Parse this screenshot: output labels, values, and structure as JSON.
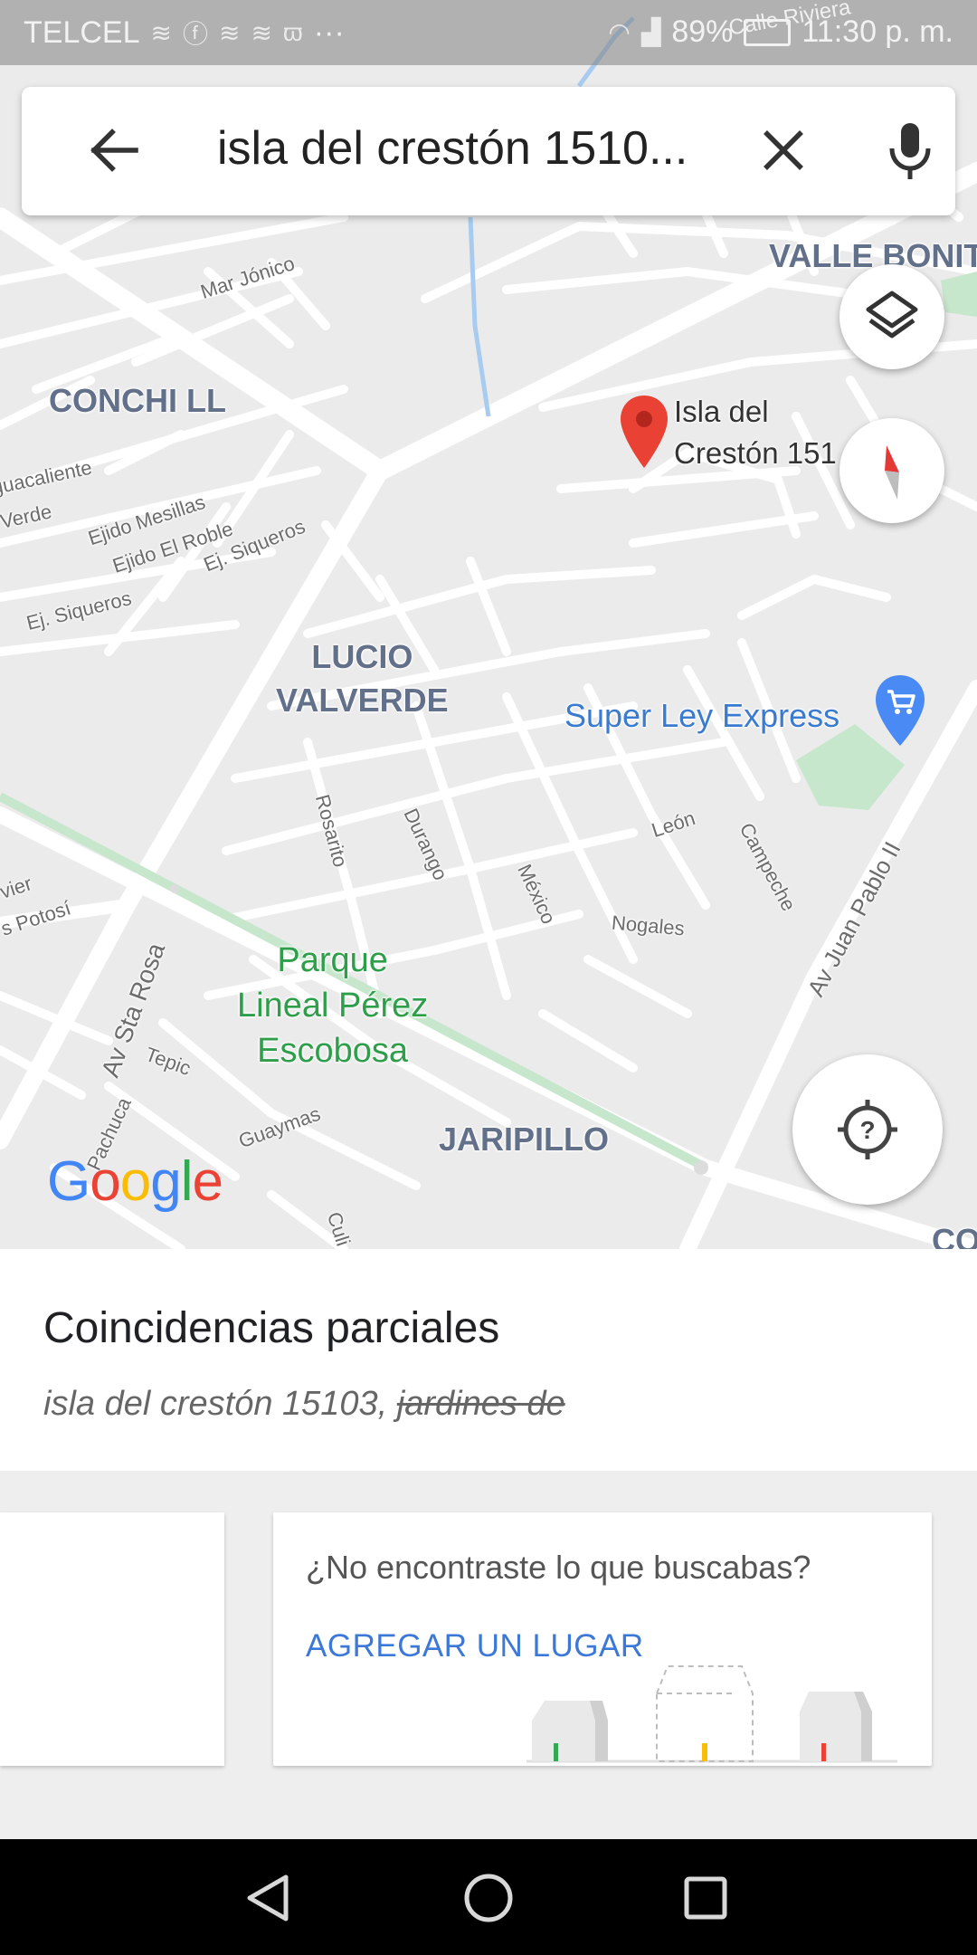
{
  "status_bar": {
    "carrier": "TELCEL",
    "notification_icons": [
      "message-icon",
      "facebook-icon",
      "message-icon",
      "message-icon",
      "w-icon"
    ],
    "more": "···",
    "battery": "89%",
    "time": "11:30 p. m."
  },
  "search": {
    "query": "isla del crestón 1510..."
  },
  "map": {
    "neighborhoods": [
      "CONCHI LL",
      "LUCIO VALVERDE",
      "VALLE BONIT",
      "JARIPILLO"
    ],
    "streets": {
      "mar_jonico": "Mar Jónico",
      "guacaliente": "guacaliente",
      "verde": "Verde",
      "ejido_mesillas": "Ejido Mesillas",
      "ejido_el_roble": "Ejido El Roble",
      "ej_siqueros_1": "Ej. Siqueros",
      "ej_siqueros_2": "Ej. Siqueros",
      "rosarito": "Rosarito",
      "durango": "Durango",
      "mexico": "México",
      "leon": "León",
      "nogales": "Nogales",
      "campeche": "Campeche",
      "av_juan_pablo": "Av Juan Pablo II",
      "av_sta_rosa": "Av Sta Rosa",
      "tepic": "Tepic",
      "pachuca": "Pachuca",
      "guaymas": "Guaymas",
      "vier": "vier",
      "potosi": "s Potosí",
      "calle_riviera": "Calle Riviera",
      "culi": "Culi",
      "co": "CO"
    },
    "park": [
      "Parque",
      "Lineal Pérez",
      "Escobosa"
    ],
    "poi": "Super Ley Express",
    "place_pin": [
      "Isla del",
      "Crestón 151"
    ],
    "google_logo": [
      "G",
      "o",
      "o",
      "g",
      "l",
      "e"
    ],
    "google_colors": [
      "#4285F4",
      "#EA4335",
      "#FBBC05",
      "#4285F4",
      "#34A853",
      "#EA4335"
    ]
  },
  "sheet": {
    "title": "Coincidencias parciales",
    "query_plain": "isla del crestón 15103, ",
    "query_struck": "jardines de"
  },
  "add_card": {
    "prompt": "¿No encontraste lo que buscabas?",
    "button": "AGREGAR UN LUGAR"
  },
  "colors": {
    "pin": "#e94235",
    "accent_blue": "#3b78d8",
    "park_green": "#2f9e4b"
  }
}
